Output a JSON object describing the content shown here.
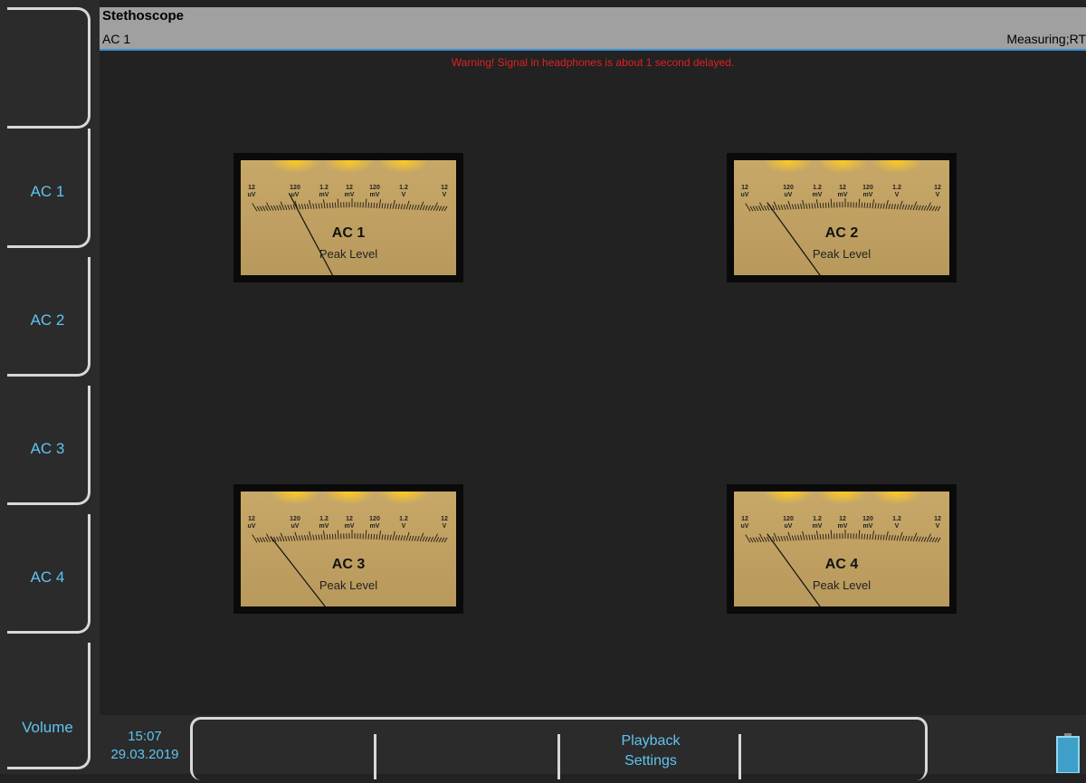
{
  "header": {
    "title": "Stethoscope",
    "subtitle": "AC 1",
    "status": "Measuring;RT"
  },
  "warning": "Warning! Signal in headphones is about 1 second delayed.",
  "sidebar": {
    "items": [
      "",
      "AC 1",
      "AC 2",
      "AC 3",
      "AC 4",
      "Volume"
    ]
  },
  "meters": [
    {
      "name": "AC 1",
      "type": "Peak Level"
    },
    {
      "name": "AC 2",
      "type": "Peak Level"
    },
    {
      "name": "AC 3",
      "type": "Peak Level"
    },
    {
      "name": "AC 4",
      "type": "Peak Level"
    }
  ],
  "scale_labels": [
    "12\nuV",
    "120\nuV",
    "1.2\nmV",
    "12\nmV",
    "120\nmV",
    "1.2\nV",
    "12\nV"
  ],
  "footer": {
    "time": "15:07",
    "date": "29.03.2019",
    "softkeys": [
      "",
      "",
      "Playback Settings",
      ""
    ]
  },
  "colors": {
    "accent": "#5fc4f2",
    "warning": "#e02020",
    "header_bg": "#a0a0a0",
    "meter_face": "#c8a868"
  }
}
